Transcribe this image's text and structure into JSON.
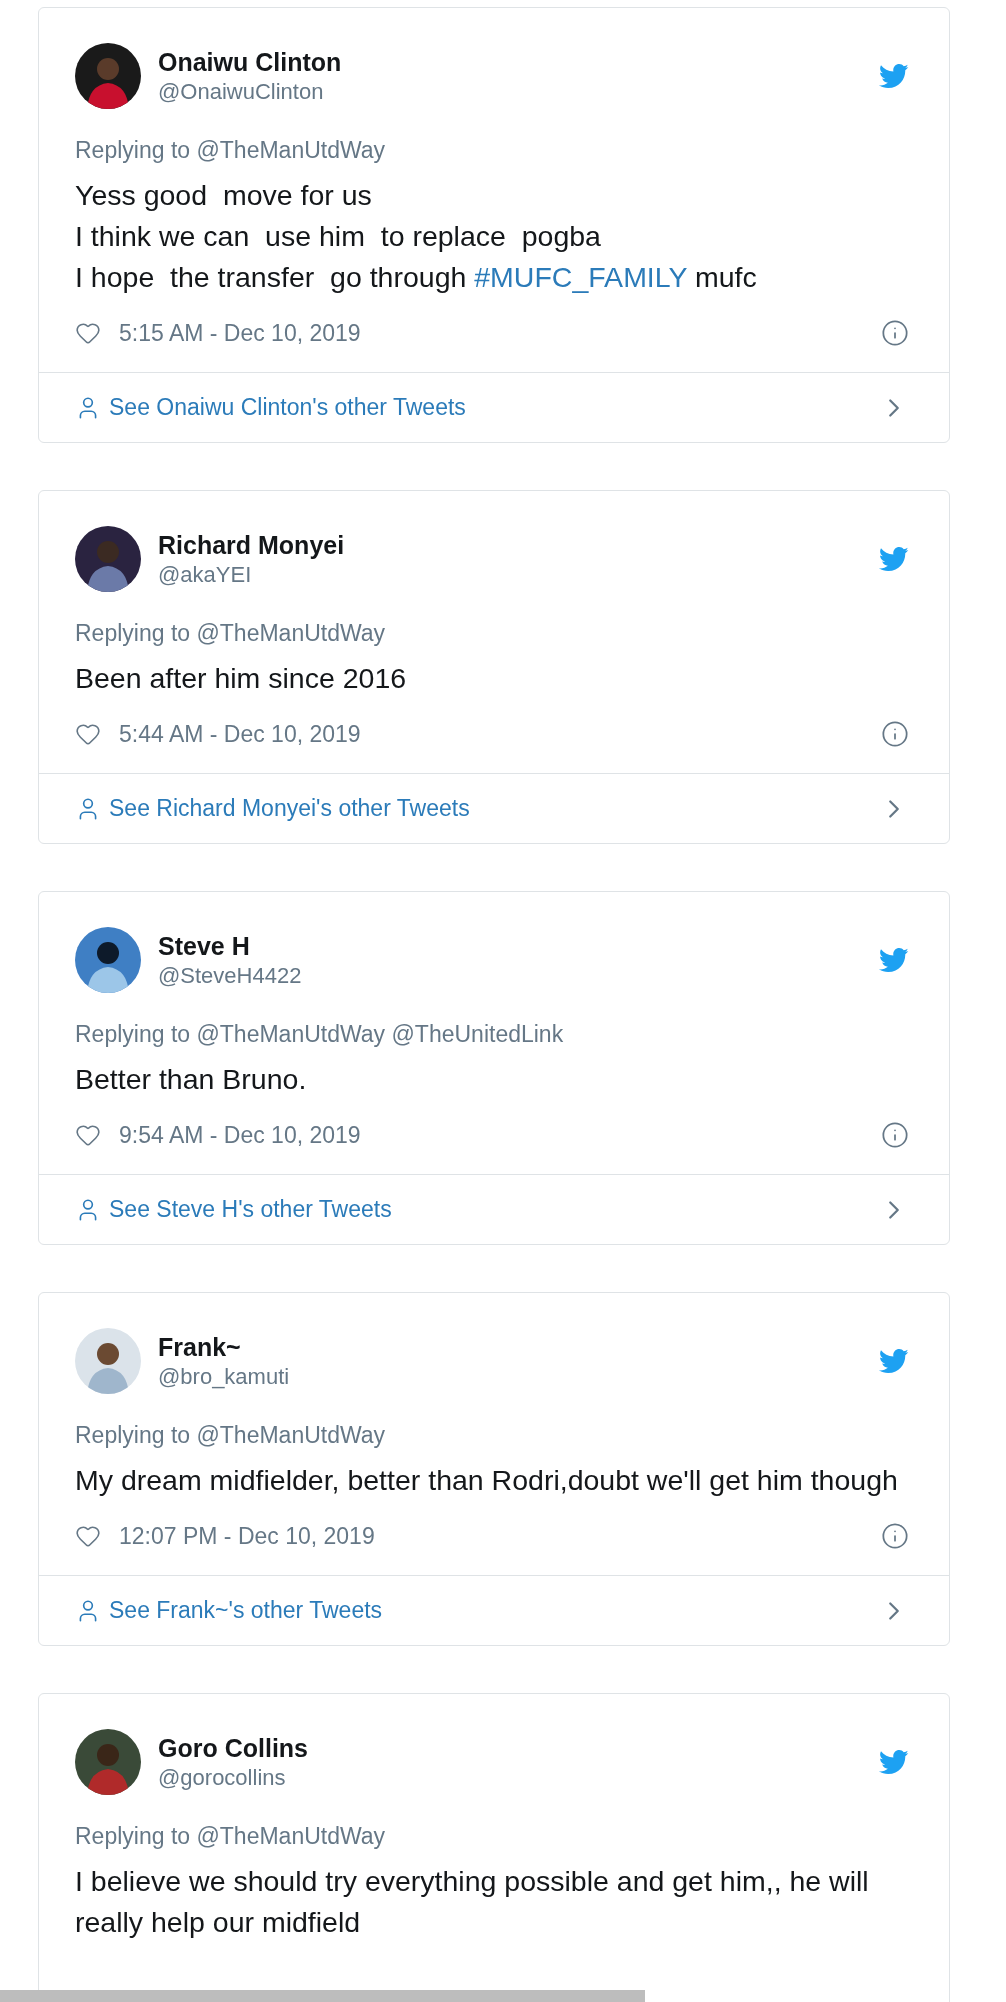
{
  "tweets": [
    {
      "name": "Onaiwu Clinton",
      "handle": "@OnaiwuClinton",
      "reply_to": "Replying to @TheManUtdWay",
      "text": [
        {
          "t": "Yess good  move for us\nI think we can  use him  to replace  pogba\nI hope  the transfer  go through "
        },
        {
          "t": "#MUFC_FAMILY",
          "kind": "hashtag"
        },
        {
          "t": " mufc"
        }
      ],
      "time": "5:15 AM - Dec 10, 2019",
      "more": "See Onaiwu Clinton's other Tweets"
    },
    {
      "name": "Richard Monyei",
      "handle": "@akaYEI",
      "reply_to": "Replying to @TheManUtdWay",
      "text": [
        {
          "t": "Been after him since 2016"
        }
      ],
      "time": "5:44 AM - Dec 10, 2019",
      "more": "See Richard Monyei's other Tweets"
    },
    {
      "name": "Steve H",
      "handle": "@SteveH4422",
      "reply_to": "Replying to @TheManUtdWay @TheUnitedLink",
      "text": [
        {
          "t": "Better than Bruno."
        }
      ],
      "time": "9:54 AM - Dec 10, 2019",
      "more": "See Steve H's other Tweets"
    },
    {
      "name": "Frank~",
      "handle": "@bro_kamuti",
      "reply_to": "Replying to @TheManUtdWay",
      "text": [
        {
          "t": "My dream midfielder, better than Rodri,doubt we'll get him though"
        }
      ],
      "time": "12:07 PM - Dec 10, 2019",
      "more": "See Frank~'s other Tweets"
    },
    {
      "name": "Goro Collins",
      "handle": "@gorocollins",
      "reply_to": "Replying to @TheManUtdWay",
      "text": [
        {
          "t": "I believe we should try everything possible and get him,, he will really help our midfield"
        }
      ]
    }
  ]
}
